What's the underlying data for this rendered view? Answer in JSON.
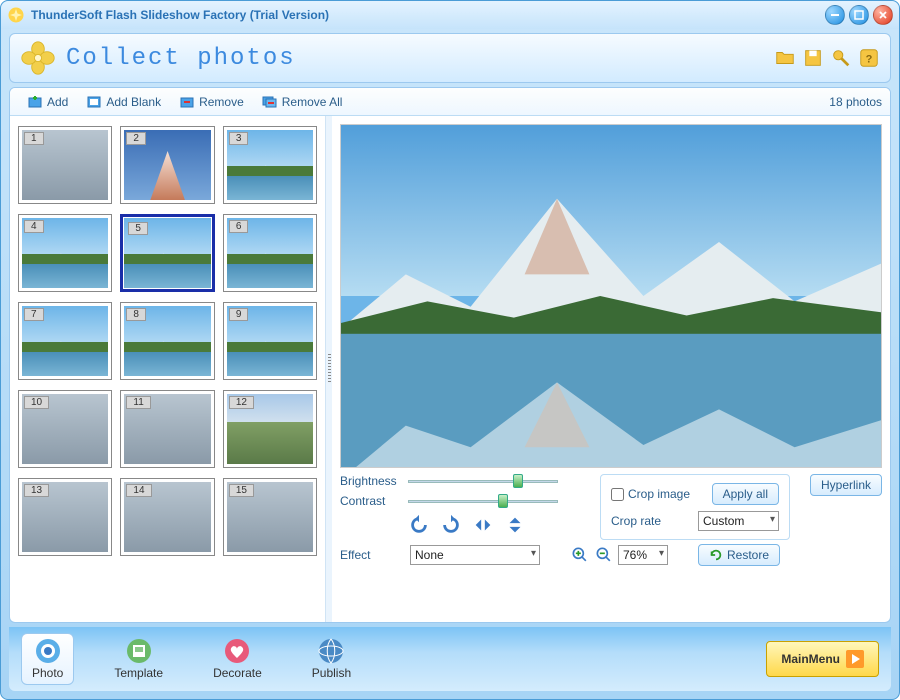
{
  "window": {
    "title": "ThunderSoft Flash Slideshow Factory (Trial Version)"
  },
  "header": {
    "title": "Collect photos"
  },
  "toolbar": {
    "add": "Add",
    "add_blank": "Add Blank",
    "remove": "Remove",
    "remove_all": "Remove All",
    "photo_count": "18 photos"
  },
  "thumbs": {
    "selected_index": 5,
    "items": [
      {
        "n": "1",
        "kind": "town"
      },
      {
        "n": "2",
        "kind": "peak"
      },
      {
        "n": "3",
        "kind": "sky"
      },
      {
        "n": "4",
        "kind": "sky"
      },
      {
        "n": "5",
        "kind": "sky"
      },
      {
        "n": "6",
        "kind": "sky"
      },
      {
        "n": "7",
        "kind": "sky"
      },
      {
        "n": "8",
        "kind": "sky"
      },
      {
        "n": "9",
        "kind": "sky"
      },
      {
        "n": "10",
        "kind": "town"
      },
      {
        "n": "11",
        "kind": "town"
      },
      {
        "n": "12",
        "kind": "trees"
      },
      {
        "n": "13",
        "kind": "town"
      },
      {
        "n": "14",
        "kind": "town"
      },
      {
        "n": "15",
        "kind": "town"
      }
    ]
  },
  "controls": {
    "brightness_label": "Brightness",
    "contrast_label": "Contrast",
    "crop_image_label": "Crop image",
    "apply_all_label": "Apply all",
    "crop_rate_label": "Crop rate",
    "crop_rate_value": "Custom",
    "hyperlink_label": "Hyperlink",
    "effect_label": "Effect",
    "effect_value": "None",
    "zoom_value": "76%",
    "restore_label": "Restore"
  },
  "nav": {
    "photo": "Photo",
    "template": "Template",
    "decorate": "Decorate",
    "publish": "Publish",
    "main_menu": "MainMenu"
  }
}
